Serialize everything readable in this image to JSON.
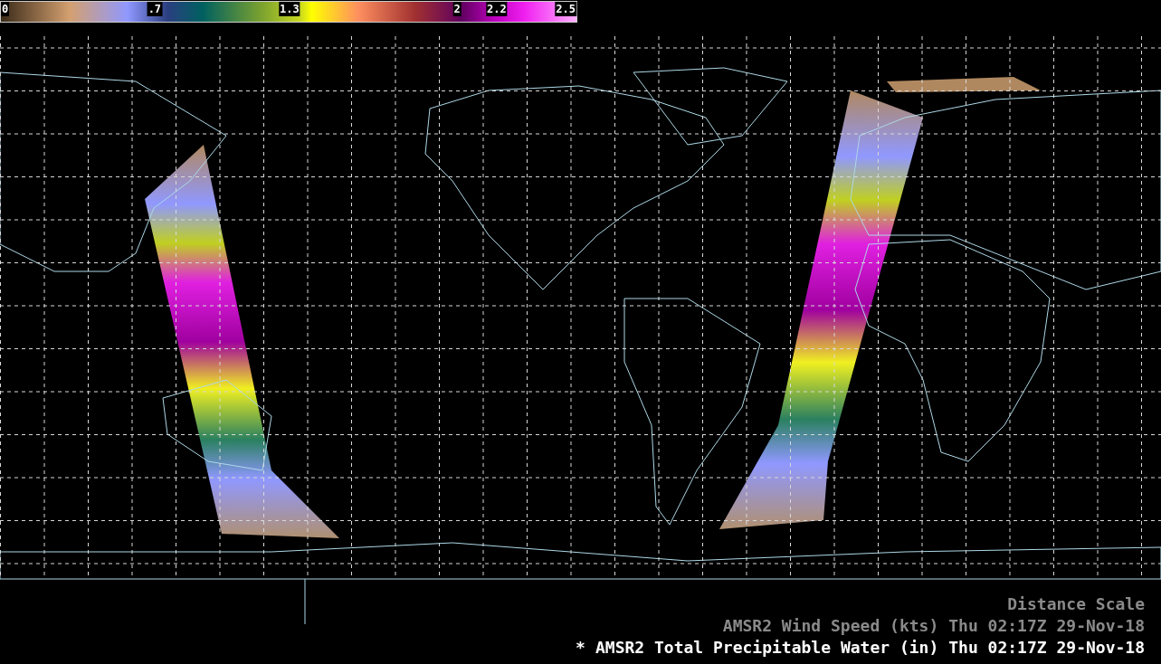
{
  "colorbar": {
    "ticks": [
      "0",
      ".7",
      "1.3",
      "2",
      "2.2",
      "2.5"
    ]
  },
  "legend": [
    {
      "name": "Distance Scale",
      "selected": false
    },
    {
      "name": "AMSR2 Wind Speed (kts)",
      "time": "Thu 02:17Z 29-Nov-18",
      "selected": false
    },
    {
      "marker": "*",
      "name": "AMSR2 Total Precipitable Water (in)",
      "time": "Thu 02:17Z 29-Nov-18",
      "selected": true
    }
  ]
}
